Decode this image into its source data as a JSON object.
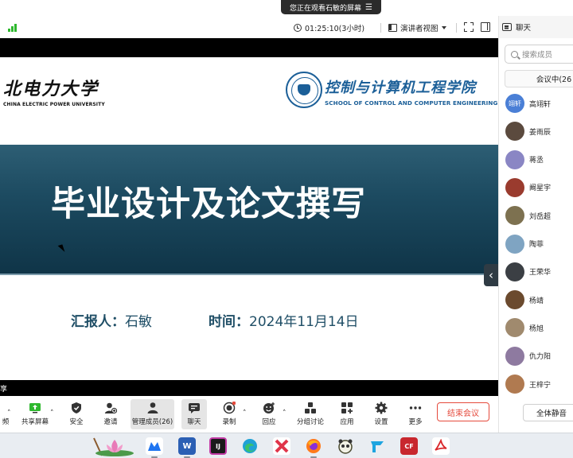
{
  "banner": {
    "text": "您正在观看石敏的屏幕"
  },
  "meeting": {
    "elapsed": "01:25:10(3小时)",
    "view_label": "演讲者视图"
  },
  "slide": {
    "logo_left_cn": "北电力大学",
    "logo_left_en": "CHINA ELECTRIC POWER UNIVERSITY",
    "logo_right_cn": "控制与计算机工程学院",
    "logo_right_en": "SCHOOL OF CONTROL AND COMPUTER ENGINEERING",
    "title": "毕业设计及论文撰写",
    "reporter_label": "汇报人：",
    "reporter_name": "石敏",
    "date_label": "时间：",
    "date_value": "2024年11月14日"
  },
  "share_caption": "享",
  "panel": {
    "title": "聊天",
    "search_placeholder": "搜索成员",
    "tab_label": "会议中(26",
    "mute_all": "全体静音",
    "members": [
      {
        "name": "高翊轩",
        "avatar_text": "翊轩",
        "color": "#4a7fd6"
      },
      {
        "name": "姜雨辰",
        "avatar_text": "",
        "color": "#5b4a3e"
      },
      {
        "name": "蒋丞",
        "avatar_text": "",
        "color": "#8a86c4"
      },
      {
        "name": "阚星宇",
        "avatar_text": "",
        "color": "#9a3b2e"
      },
      {
        "name": "刘岳超",
        "avatar_text": "",
        "color": "#7d7150"
      },
      {
        "name": "陶菲",
        "avatar_text": "",
        "color": "#7fa4c2"
      },
      {
        "name": "王荣华",
        "avatar_text": "",
        "color": "#3b3f44"
      },
      {
        "name": "杨靖",
        "avatar_text": "",
        "color": "#6b4a2e"
      },
      {
        "name": "杨旭",
        "avatar_text": "",
        "color": "#a08a6e"
      },
      {
        "name": "仇力阳",
        "avatar_text": "",
        "color": "#8e7aa0"
      },
      {
        "name": "王梓宁",
        "avatar_text": "",
        "color": "#b07a50"
      }
    ]
  },
  "toolbar": {
    "video_label": "频",
    "share_label": "共享屏幕",
    "security_label": "安全",
    "invite_label": "邀请",
    "members_label": "管理成员(26)",
    "chat_label": "聊天",
    "record_label": "录制",
    "reaction_label": "回应",
    "breakout_label": "分组讨论",
    "apps_label": "应用",
    "settings_label": "设置",
    "more_label": "更多",
    "end_label": "结束会议"
  },
  "taskbar": {
    "word_label": "W",
    "jetbrains_label": "IJ",
    "cf_label": "CF"
  },
  "colors": {
    "accent": "#e54a3c",
    "slide_band": "#1c4a60",
    "slide_text": "#1f4e66",
    "school_blue": "#1b5f98",
    "signal": "#2eb82e"
  }
}
